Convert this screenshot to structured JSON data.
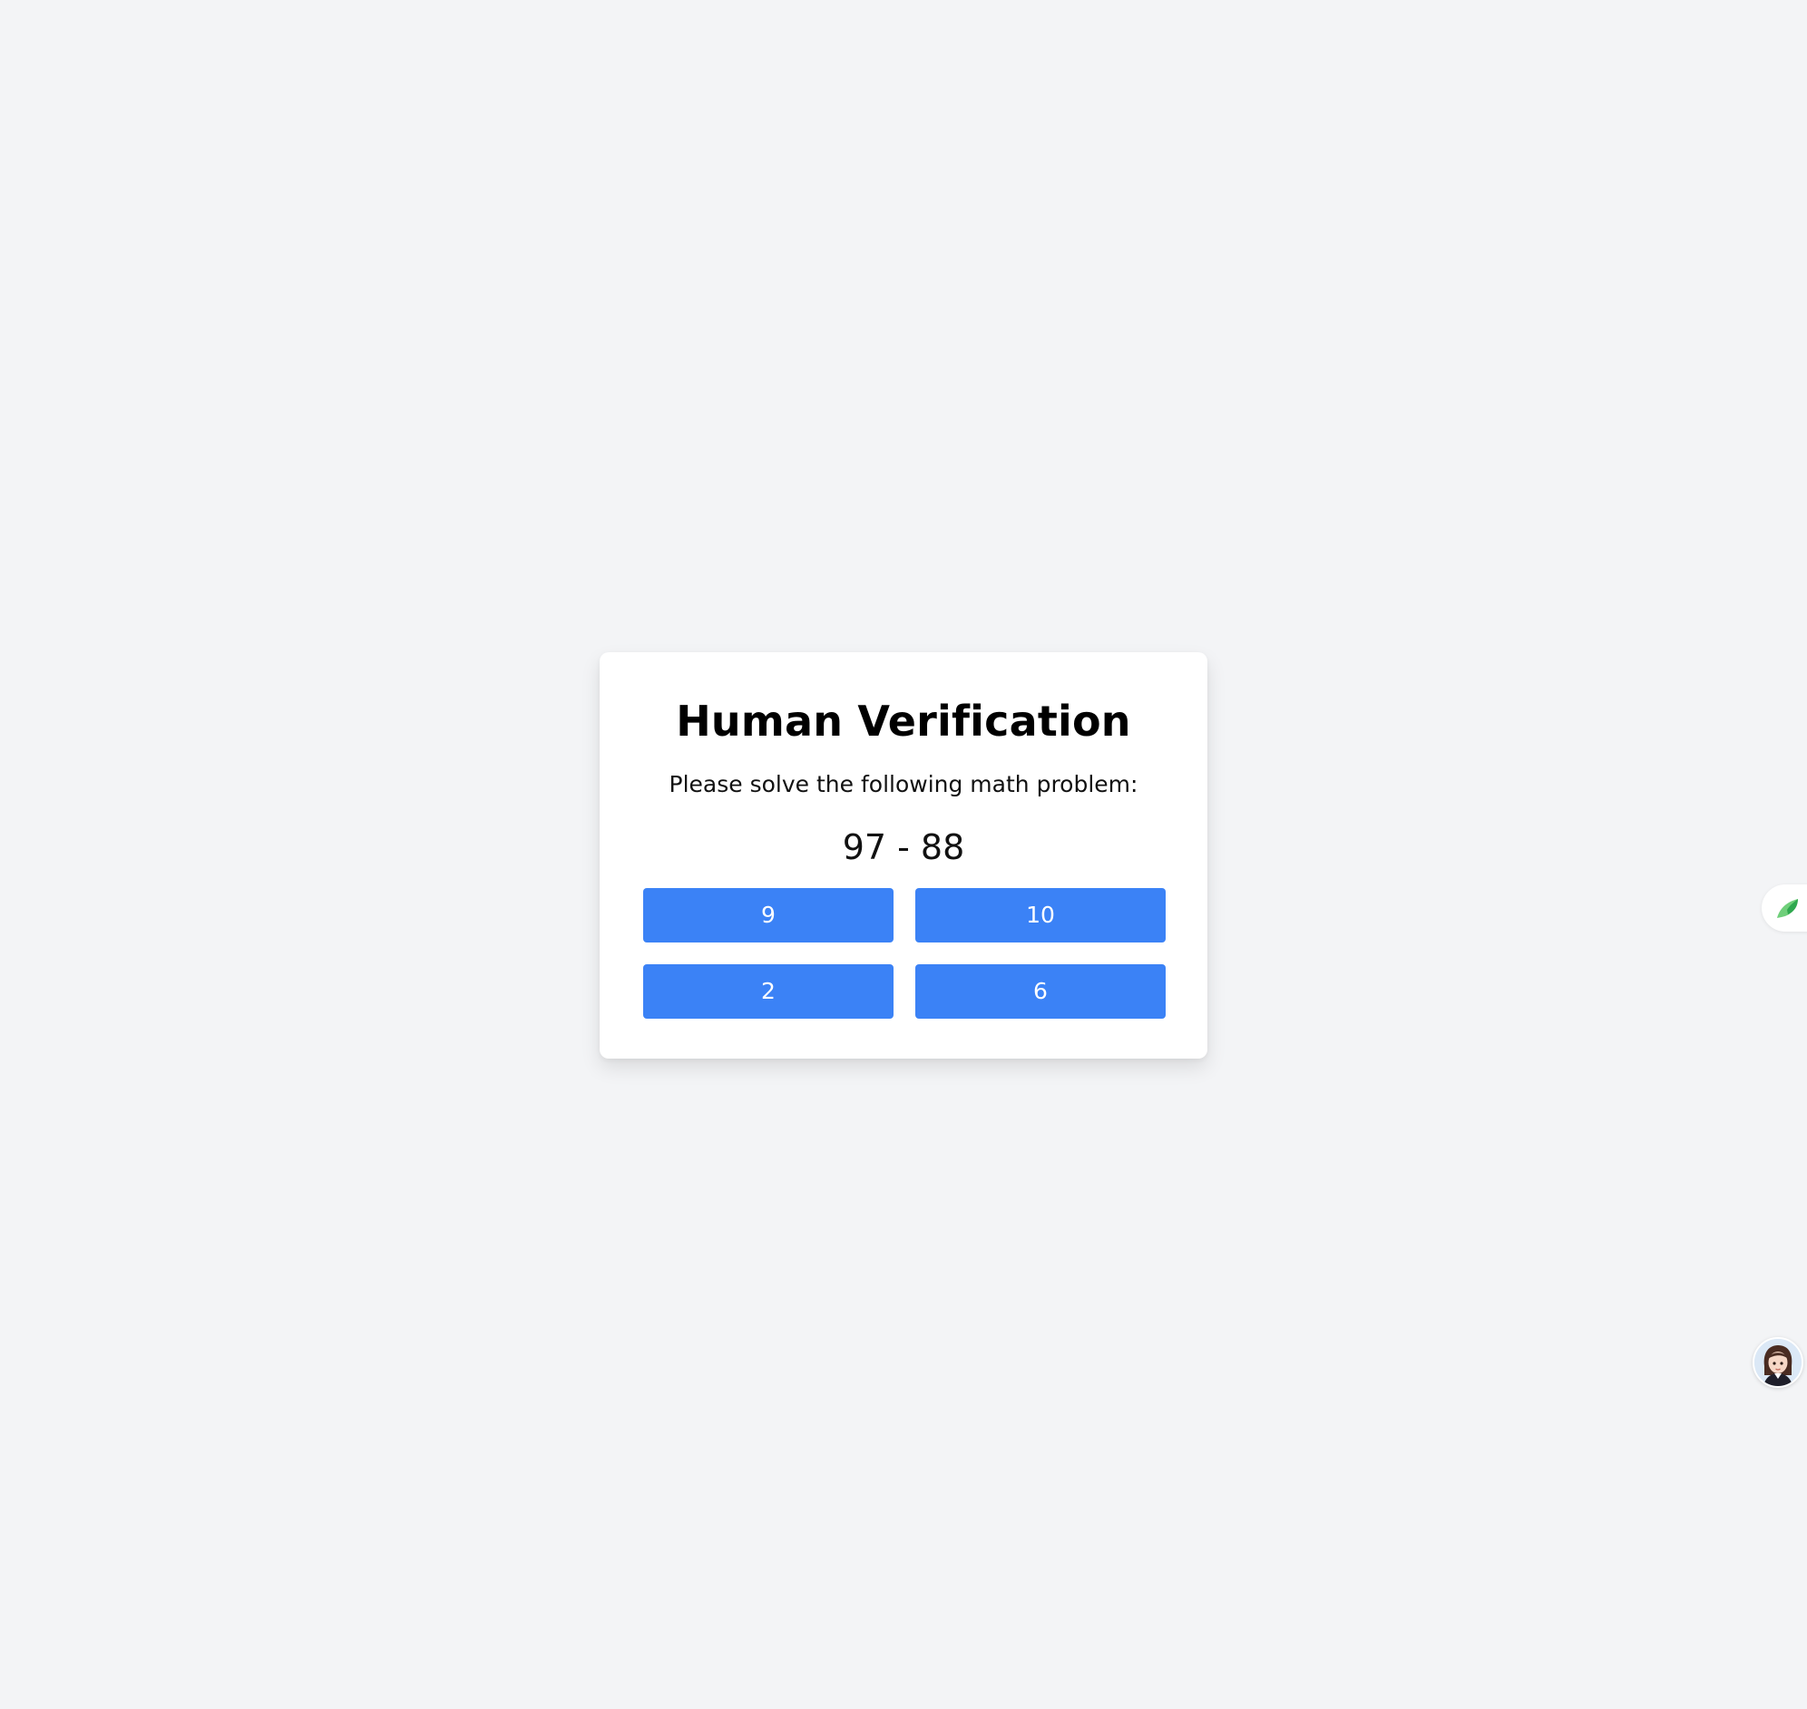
{
  "card": {
    "title": "Human Verification",
    "prompt": "Please solve the following math problem:",
    "problem": "97 - 88"
  },
  "answers": [
    {
      "label": "9"
    },
    {
      "label": "10"
    },
    {
      "label": "2"
    },
    {
      "label": "6"
    }
  ],
  "widgets": {
    "side_tab_icon": "leaf-icon",
    "assistant_icon": "assistant-avatar-icon"
  },
  "colors": {
    "background": "#f3f4f6",
    "card": "#ffffff",
    "button": "#3b82f6",
    "button_text": "#ffffff"
  }
}
